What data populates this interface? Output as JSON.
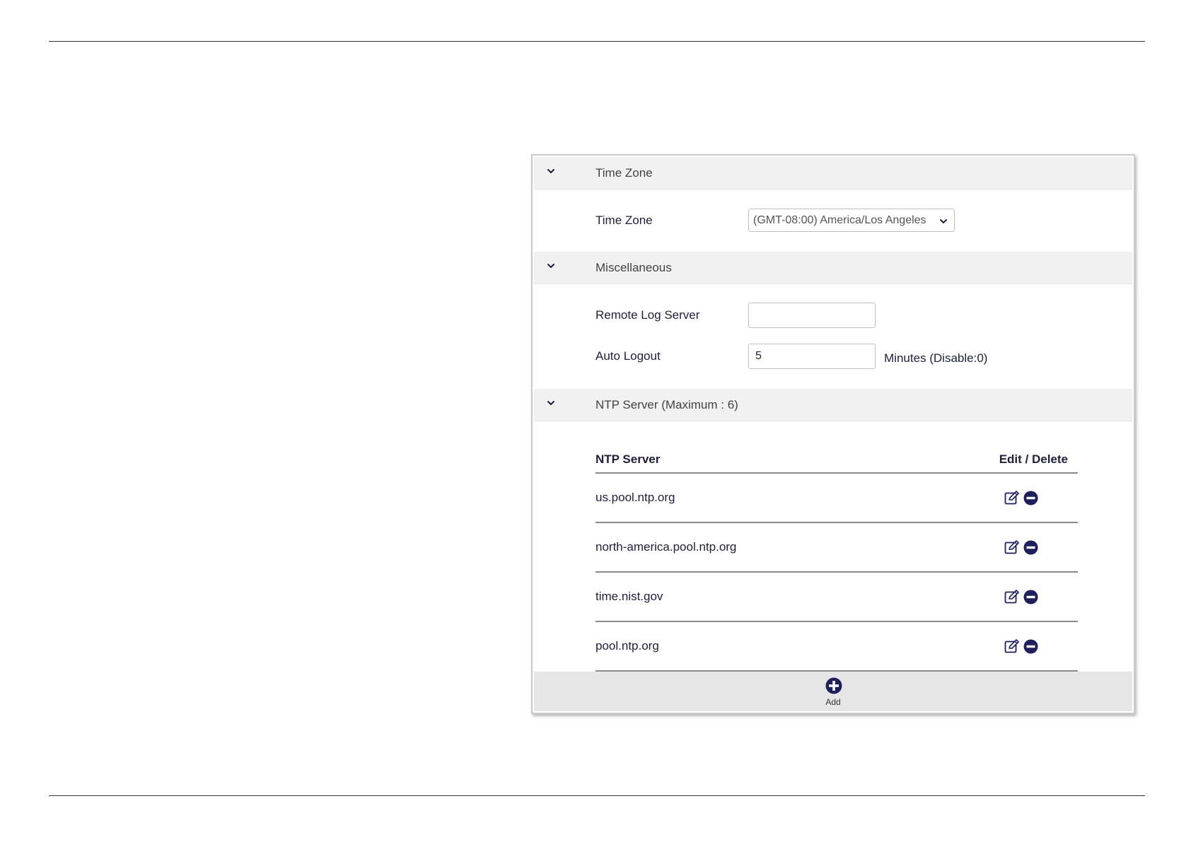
{
  "sections": {
    "time_zone": {
      "title": "Time Zone",
      "field_label": "Time Zone",
      "selected_value": "(GMT-08:00) America/Los Angeles"
    },
    "miscellaneous": {
      "title": "Miscellaneous",
      "remote_log_label": "Remote Log Server",
      "remote_log_value": "",
      "auto_logout_label": "Auto Logout",
      "auto_logout_value": "5",
      "auto_logout_suffix": "Minutes (Disable:0)"
    },
    "ntp": {
      "title": "NTP Server (Maximum : 6)",
      "col_server": "NTP Server",
      "col_actions": "Edit / Delete",
      "servers": [
        "us.pool.ntp.org",
        "north-america.pool.ntp.org",
        "time.nist.gov",
        "pool.ntp.org"
      ],
      "add_label": "Add"
    }
  },
  "icons": {
    "chevron": "chevron-down-icon",
    "edit": "edit-icon",
    "delete": "delete-icon",
    "add": "add-icon"
  },
  "colors": {
    "accent": "#1f1f5c",
    "header_bg": "#f1f1f1",
    "footer_bg": "#e6e6e6"
  }
}
